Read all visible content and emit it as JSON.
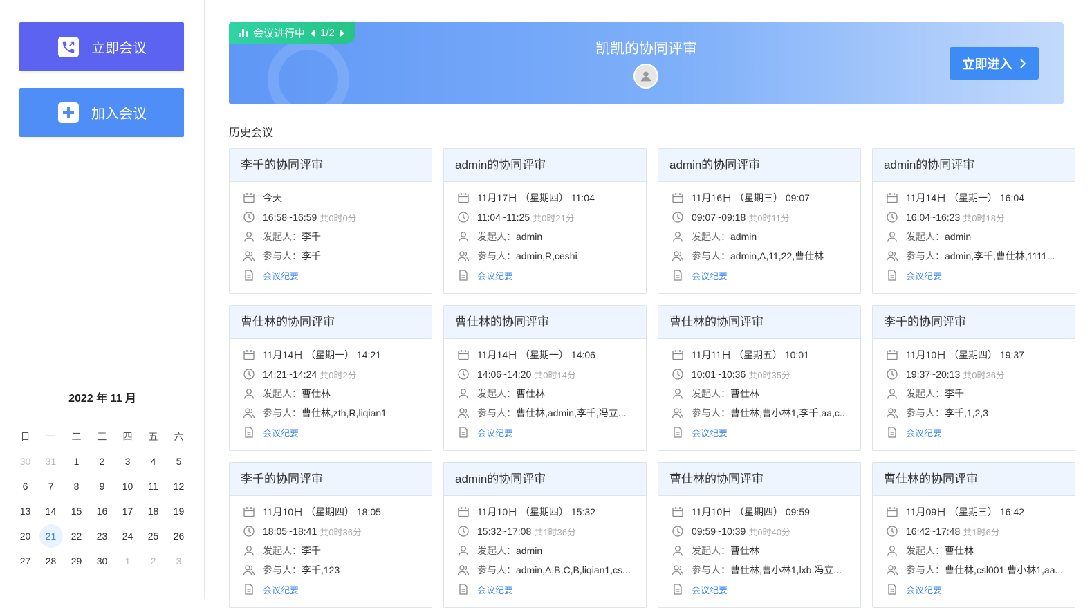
{
  "sidebar": {
    "start_label": "立即会议",
    "join_label": "加入会议"
  },
  "calendar": {
    "title": "2022 年 11 月",
    "weekdays": [
      "日",
      "一",
      "二",
      "三",
      "四",
      "五",
      "六"
    ],
    "days": [
      {
        "d": "30",
        "muted": true
      },
      {
        "d": "31",
        "muted": true
      },
      {
        "d": "1"
      },
      {
        "d": "2"
      },
      {
        "d": "3"
      },
      {
        "d": "4"
      },
      {
        "d": "5"
      },
      {
        "d": "6"
      },
      {
        "d": "7"
      },
      {
        "d": "8"
      },
      {
        "d": "9"
      },
      {
        "d": "10"
      },
      {
        "d": "11"
      },
      {
        "d": "12"
      },
      {
        "d": "13"
      },
      {
        "d": "14"
      },
      {
        "d": "15"
      },
      {
        "d": "16"
      },
      {
        "d": "17"
      },
      {
        "d": "18"
      },
      {
        "d": "19"
      },
      {
        "d": "20"
      },
      {
        "d": "21",
        "today": true
      },
      {
        "d": "22"
      },
      {
        "d": "23"
      },
      {
        "d": "24"
      },
      {
        "d": "25"
      },
      {
        "d": "26"
      },
      {
        "d": "27"
      },
      {
        "d": "28"
      },
      {
        "d": "29"
      },
      {
        "d": "30"
      },
      {
        "d": "1",
        "muted": true
      },
      {
        "d": "2",
        "muted": true
      },
      {
        "d": "3",
        "muted": true
      }
    ]
  },
  "banner": {
    "status": "会议进行中",
    "pager": "1/2",
    "title": "凯凯的协同评审",
    "enter_label": "立即进入"
  },
  "history_title": "历史会议",
  "labels": {
    "initiator": "发起人：",
    "participants": "参与人：",
    "minutes": "会议纪要"
  },
  "meetings": [
    {
      "title": "李千的协同评审",
      "date": "今天",
      "time": "16:58~16:59",
      "duration": "共0时0分",
      "initiator": "李千",
      "participants": "李千"
    },
    {
      "title": "admin的协同评审",
      "date": "11月17日 （星期四） 11:04",
      "time": "11:04~11:25",
      "duration": "共0时21分",
      "initiator": "admin",
      "participants": "admin,R,ceshi"
    },
    {
      "title": "admin的协同评审",
      "date": "11月16日 （星期三） 09:07",
      "time": "09:07~09:18",
      "duration": "共0时11分",
      "initiator": "admin",
      "participants": "admin,A,11,22,曹仕林"
    },
    {
      "title": "admin的协同评审",
      "date": "11月14日 （星期一） 16:04",
      "time": "16:04~16:23",
      "duration": "共0时18分",
      "initiator": "admin",
      "participants": "admin,李千,曹仕林,1111..."
    },
    {
      "title": "曹仕林的协同评审",
      "date": "11月14日 （星期一） 14:21",
      "time": "14:21~14:24",
      "duration": "共0时2分",
      "initiator": "曹仕林",
      "participants": "曹仕林,zth,R,liqian1"
    },
    {
      "title": "曹仕林的协同评审",
      "date": "11月14日 （星期一） 14:06",
      "time": "14:06~14:20",
      "duration": "共0时14分",
      "initiator": "曹仕林",
      "participants": "曹仕林,admin,李千,冯立..."
    },
    {
      "title": "曹仕林的协同评审",
      "date": "11月11日 （星期五） 10:01",
      "time": "10:01~10:36",
      "duration": "共0时35分",
      "initiator": "曹仕林",
      "participants": "曹仕林,曹小林1,李千,aa,c..."
    },
    {
      "title": "李千的协同评审",
      "date": "11月10日 （星期四） 19:37",
      "time": "19:37~20:13",
      "duration": "共0时36分",
      "initiator": "李千",
      "participants": "李千,1,2,3"
    },
    {
      "title": "李千的协同评审",
      "date": "11月10日 （星期四） 18:05",
      "time": "18:05~18:41",
      "duration": "共0时36分",
      "initiator": "李千",
      "participants": "李千,123"
    },
    {
      "title": "admin的协同评审",
      "date": "11月10日 （星期四） 15:32",
      "time": "15:32~17:08",
      "duration": "共1时36分",
      "initiator": "admin",
      "participants": "admin,A,B,C,B,liqian1,cs..."
    },
    {
      "title": "曹仕林的协同评审",
      "date": "11月10日 （星期四） 09:59",
      "time": "09:59~10:39",
      "duration": "共0时40分",
      "initiator": "曹仕林",
      "participants": "曹仕林,曹小林1,lxb,冯立..."
    },
    {
      "title": "曹仕林的协同评审",
      "date": "11月09日 （星期三） 16:42",
      "time": "16:42~17:48",
      "duration": "共1时6分",
      "initiator": "曹仕林",
      "participants": "曹仕林,csl001,曹小林1,aa..."
    }
  ]
}
